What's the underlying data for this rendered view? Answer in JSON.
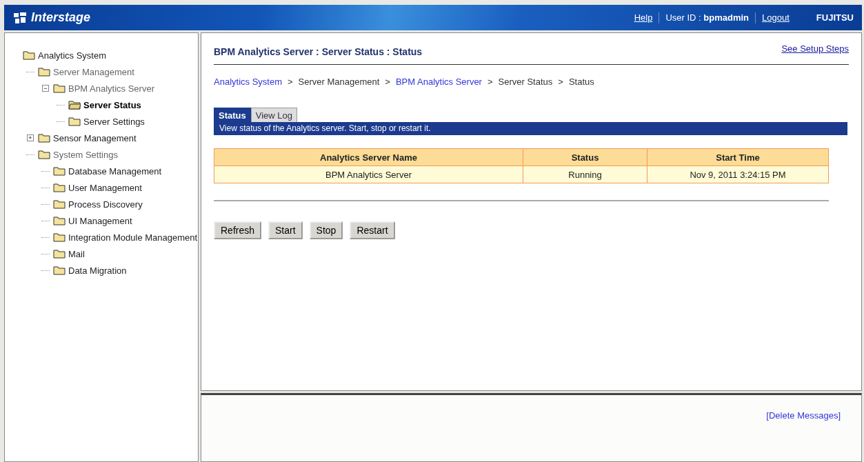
{
  "header": {
    "brand": "Interstage",
    "links": [
      {
        "kind": "link",
        "text": "Help"
      },
      {
        "kind": "user",
        "label": "User ID : ",
        "value": "bpmadmin"
      },
      {
        "kind": "link",
        "text": "Logout"
      }
    ],
    "vendor": "FUJITSU"
  },
  "tree": [
    {
      "label": "Analytics System",
      "selected": false,
      "disabled": false,
      "children": [
        {
          "label": "Server Management",
          "selected": false,
          "disabled": true,
          "children": [
            {
              "label": "BPM Analytics Server",
              "toggle": "−",
              "selected": false,
              "disabled": true,
              "children": [
                {
                  "label": "Server Status",
                  "selected": true,
                  "disabled": false
                },
                {
                  "label": "Server Settings",
                  "selected": false,
                  "disabled": false
                }
              ]
            }
          ]
        },
        {
          "label": "Sensor Management",
          "toggle": "+",
          "selected": false,
          "disabled": false
        },
        {
          "label": "System Settings",
          "selected": false,
          "disabled": true,
          "children": [
            {
              "label": "Database Management",
              "selected": false,
              "disabled": false
            },
            {
              "label": "User Management",
              "selected": false,
              "disabled": false
            },
            {
              "label": "Process Discovery",
              "selected": false,
              "disabled": false
            },
            {
              "label": "UI Management",
              "selected": false,
              "disabled": false
            },
            {
              "label": "Integration Module Management",
              "selected": false,
              "disabled": false
            },
            {
              "label": "Mail",
              "selected": false,
              "disabled": false
            },
            {
              "label": "Data Migration",
              "selected": false,
              "disabled": false
            }
          ]
        }
      ]
    }
  ],
  "page": {
    "title": "BPM Analytics Server : Server Status : Status",
    "setup_link": "See Setup Steps",
    "breadcrumb": [
      {
        "text": "Analytics System",
        "link": true,
        "separator": ">"
      },
      {
        "text": "Server Management",
        "link": false,
        "separator": ">"
      },
      {
        "text": "BPM Analytics Server",
        "link": true,
        "separator": ">"
      },
      {
        "text": "Server Status",
        "link": false,
        "separator": ">"
      },
      {
        "text": "Status",
        "link": false
      }
    ],
    "tabs": [
      {
        "label": "Status",
        "selected": true
      },
      {
        "label": "View Log",
        "selected": false
      }
    ],
    "description": "View status of the Analytics server. Start, stop or restart it.",
    "table": {
      "columns": [
        "Analytics Server Name",
        "Status",
        "Start Time"
      ],
      "rows": [
        [
          "BPM Analytics Server",
          "Running",
          "Nov 9, 2011 3:24:15 PM"
        ]
      ]
    },
    "buttons": [
      "Refresh",
      "Start",
      "Stop",
      "Restart"
    ]
  },
  "messages": {
    "delete_link": "[Delete Messages]"
  }
}
